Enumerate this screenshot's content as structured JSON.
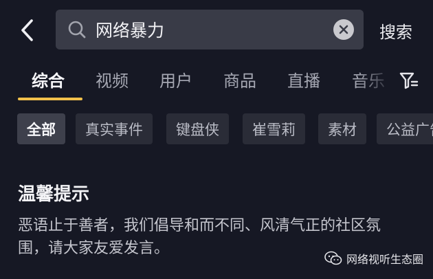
{
  "header": {
    "search_value": "网络暴力",
    "search_button": "搜索"
  },
  "tabs": [
    {
      "label": "综合",
      "active": true
    },
    {
      "label": "视频",
      "active": false
    },
    {
      "label": "用户",
      "active": false
    },
    {
      "label": "商品",
      "active": false
    },
    {
      "label": "直播",
      "active": false
    },
    {
      "label": "音乐",
      "active": false
    }
  ],
  "chips": [
    {
      "label": "全部",
      "active": true
    },
    {
      "label": "真实事件",
      "active": false
    },
    {
      "label": "键盘侠",
      "active": false
    },
    {
      "label": "崔雪莉",
      "active": false
    },
    {
      "label": "素材",
      "active": false
    },
    {
      "label": "公益广告",
      "active": false
    }
  ],
  "notice": {
    "title": "温馨提示",
    "body": "恶语止于善者，我们倡导和而不同、风清气正的社区氛围，请大家友爱发言。"
  },
  "watermark": {
    "text": "网络视听生态圈"
  },
  "colors": {
    "background": "#161824",
    "search_box": "#393b47",
    "chip": "#2a2c37",
    "chip_active": "#3e404c",
    "tab_underline": "#f2c14b"
  },
  "icons": {
    "back": "chevron-left-icon",
    "search": "search-icon",
    "clear": "clear-icon",
    "filter": "filter-icon",
    "watermark": "wechat-icon"
  }
}
